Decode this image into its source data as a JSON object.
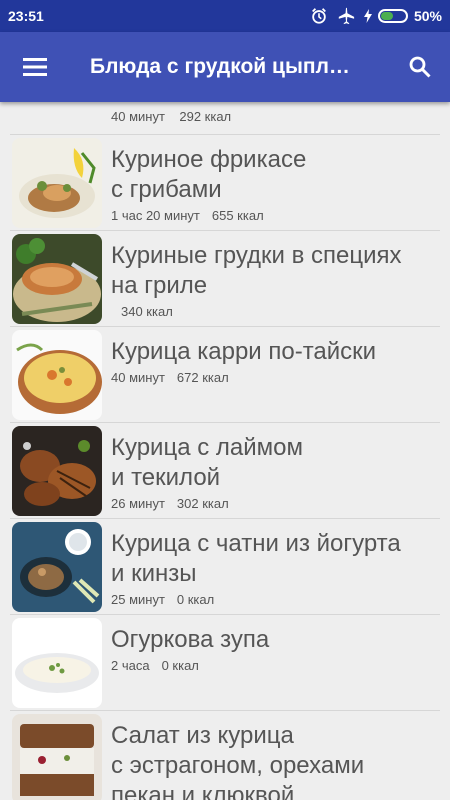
{
  "status": {
    "time": "23:51",
    "battery_percent": "50%",
    "battery_level": 0.5,
    "icons": [
      "alarm-clock-icon",
      "airplane-mode-icon",
      "charging-bolt-icon",
      "battery-icon"
    ]
  },
  "appbar": {
    "title": "Блюда с грудкой цыпл…",
    "menu_icon": "hamburger-menu-icon",
    "search_icon": "search-icon"
  },
  "partial_item": {
    "time": "40 минут",
    "kcal": "292 ккал"
  },
  "items": [
    {
      "title_lines": [
        "Куриное фрикасе",
        "с грибами"
      ],
      "time": "1 час 20 минут",
      "kcal": "655 ккал"
    },
    {
      "title_lines": [
        "Куриные грудки в специях",
        "на гриле"
      ],
      "time": "",
      "kcal": "340 ккал"
    },
    {
      "title_lines": [
        "Курица карри по-тайски"
      ],
      "time": "40 минут",
      "kcal": "672 ккал"
    },
    {
      "title_lines": [
        "Курица с лаймом",
        "и текилой"
      ],
      "time": "26 минут",
      "kcal": "302 ккал"
    },
    {
      "title_lines": [
        "Курица с чатни из йогурта",
        "и кинзы"
      ],
      "time": "25 минут",
      "kcal": "0 ккал"
    },
    {
      "title_lines": [
        "Огуркова зупа"
      ],
      "time": "2 часа",
      "kcal": "0 ккал"
    },
    {
      "title_lines": [
        "Салат из курица",
        "с эстрагоном, орехами",
        "пекан и клюквой"
      ],
      "time": "",
      "kcal": ""
    }
  ]
}
